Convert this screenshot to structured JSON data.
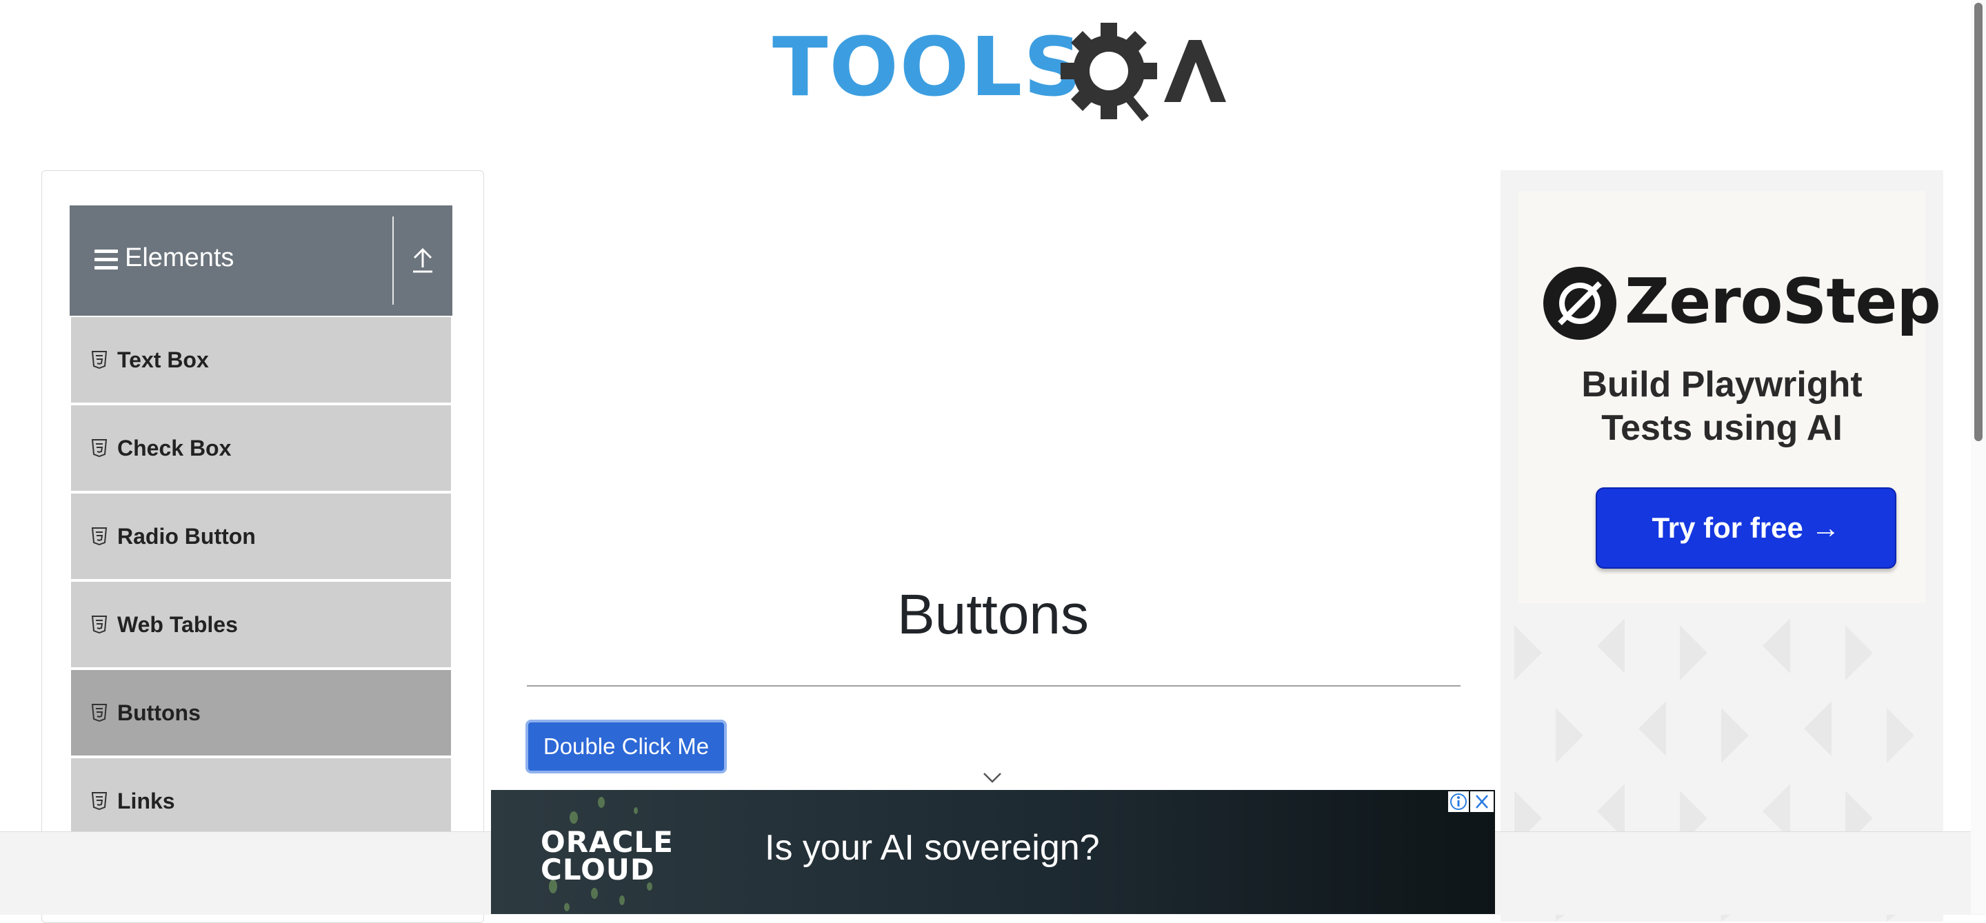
{
  "header": {
    "logo_text": "TOOLSQA"
  },
  "sidebar": {
    "group_title": "Elements",
    "items": [
      {
        "label": "Text Box",
        "active": false
      },
      {
        "label": "Check Box",
        "active": false
      },
      {
        "label": "Radio Button",
        "active": false
      },
      {
        "label": "Web Tables",
        "active": false
      },
      {
        "label": "Buttons",
        "active": true
      },
      {
        "label": "Links",
        "active": false
      }
    ]
  },
  "main": {
    "title": "Buttons",
    "double_click_label": "Double Click Me"
  },
  "right_ad": {
    "brand": "ZeroStep",
    "headline_line1": "Build Playwright",
    "headline_line2": "Tests using AI",
    "cta": "Try for free →"
  },
  "bottom_ad": {
    "logo_line1": "ORACLE",
    "logo_line2": "CLOUD",
    "tagline": "Is your AI sovereign?"
  },
  "colors": {
    "accent": "#2c68d6",
    "header_gray": "#6c757d",
    "menu_bg": "#cfcfcf",
    "menu_active": "#a8a8a8",
    "logo_blue": "#3c9ee0",
    "ad_cta": "#1537e0"
  }
}
